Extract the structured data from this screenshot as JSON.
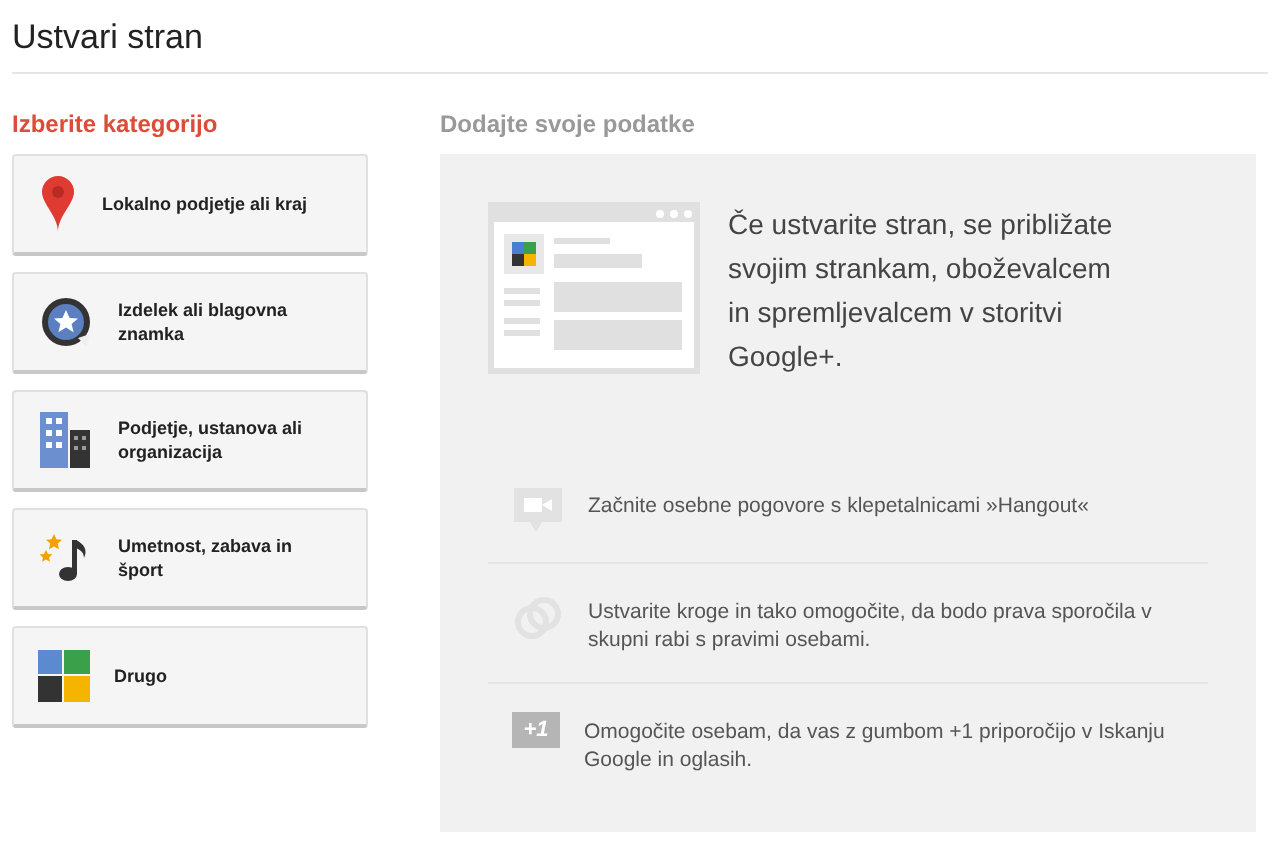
{
  "title": "Ustvari stran",
  "steps": [
    {
      "label": "Izberite kategorijo",
      "selected": true
    },
    {
      "label": "Dodajte svoje podatke",
      "selected": false
    }
  ],
  "categories": [
    {
      "kind": "pin",
      "label": "Lokalno podjetje ali kraj"
    },
    {
      "kind": "product",
      "label": "Izdelek ali blagovna znamka"
    },
    {
      "kind": "company",
      "label": "Podjetje, ustanova ali organizacija"
    },
    {
      "kind": "arts",
      "label": "Umetnost, zabava in šport"
    },
    {
      "kind": "other",
      "label": "Drugo"
    }
  ],
  "intro": "Če ustvarite stran, se približate svojim strankam, oboževalcem in spremljevalcem v storitvi Google+.",
  "features": [
    {
      "kind": "hangout",
      "text": "Začnite osebne pogovore s klepetalnicami »Hangout«"
    },
    {
      "kind": "circles",
      "text": "Ustvarite kroge in tako omogočite, da bodo prava sporočila v skupni rabi s pravimi osebami."
    },
    {
      "kind": "plusone",
      "badge": "+1",
      "text": "Omogočite osebam, da vas z gumbom +1 priporočijo v Iskanju Google in oglasih."
    }
  ]
}
